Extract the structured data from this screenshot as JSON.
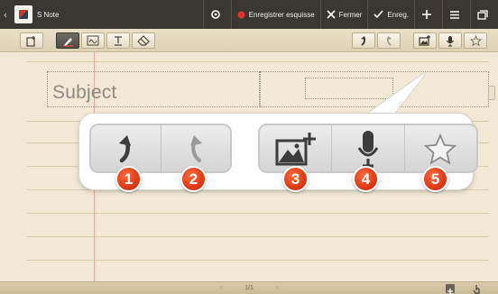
{
  "actionbar": {
    "app_title": "S Note",
    "save_sketch_label": "Enregistrer esquisse",
    "close_label": "Fermer",
    "save_label": "Enreg."
  },
  "note": {
    "subject_placeholder": "Subject"
  },
  "callout": {
    "badges": [
      "1",
      "2",
      "3",
      "4",
      "5"
    ]
  },
  "pager": {
    "page_indicator": "1/1",
    "prev_symbol": "<",
    "next_symbol": ">"
  }
}
